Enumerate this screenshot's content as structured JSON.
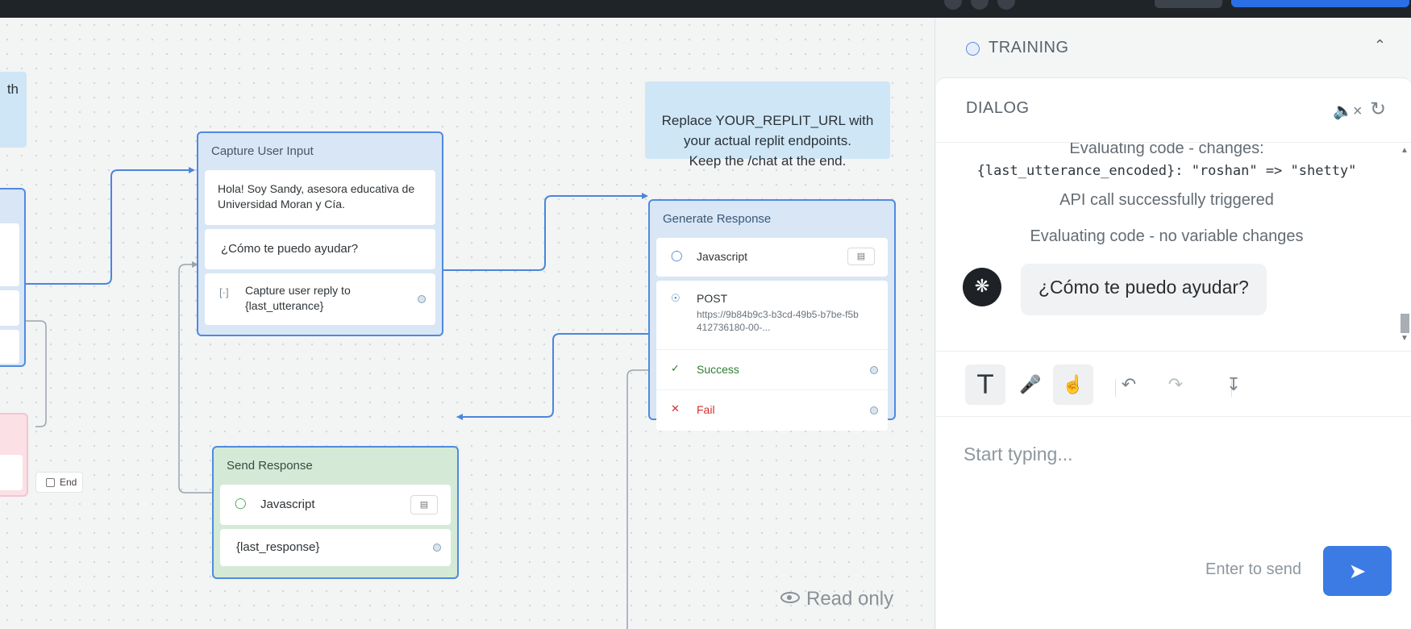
{
  "canvas": {
    "note_left_text": "th",
    "note_right_text": "Replace YOUR_REPLIT_URL with\nyour actual replit endpoints.\nKeep the /chat at the end.",
    "end_label": "End",
    "read_only_label": "Read only",
    "capture_block": {
      "title": "Capture User Input",
      "text1": "Hola! Soy Sandy, asesora educativa de Universidad Moran y Cía.",
      "text2": "¿Cómo te puedo ayudar?",
      "capture_text": "Capture user reply to {last_utterance}"
    },
    "generate_block": {
      "title": "Generate Response",
      "javascript_label": "Javascript",
      "method": "POST",
      "url": "https://9b84b9c3-b3cd-49b5-b7be-f5b412736180-00-...",
      "success_label": "Success",
      "fail_label": "Fail"
    },
    "send_block": {
      "title": "Send Response",
      "javascript_label": "Javascript",
      "text": "{last_response}"
    }
  },
  "panel": {
    "training_label": "TRAINING",
    "dialog_title": "DIALOG",
    "messages": {
      "eval_changes": "Evaluating code - changes:",
      "eval_var": "{last_utterance_encoded}",
      "eval_value": ": \"roshan\" => \"shetty\"",
      "api_call": "API call successfully triggered",
      "eval_no_changes": "Evaluating code - no variable changes",
      "bot_message": "¿Cómo te puedo ayudar?"
    },
    "input_placeholder": "Start typing...",
    "enter_hint": "Enter to send"
  },
  "colors": {
    "accent": "#3b7be3",
    "block_border": "#4f8be0",
    "success": "#2e7d32",
    "fail": "#d32f2f",
    "note_bg": "#cfe6f6"
  },
  "icons": [
    "eye-icon",
    "mute-icon",
    "reset-icon",
    "chevron-up-icon",
    "text-mode-icon",
    "mic-icon",
    "touch-icon",
    "undo-icon",
    "redo-icon",
    "download-icon",
    "send-icon",
    "javascript-icon",
    "api-icon",
    "check-icon",
    "x-icon",
    "capture-icon",
    "edit-code-icon",
    "end-icon"
  ]
}
